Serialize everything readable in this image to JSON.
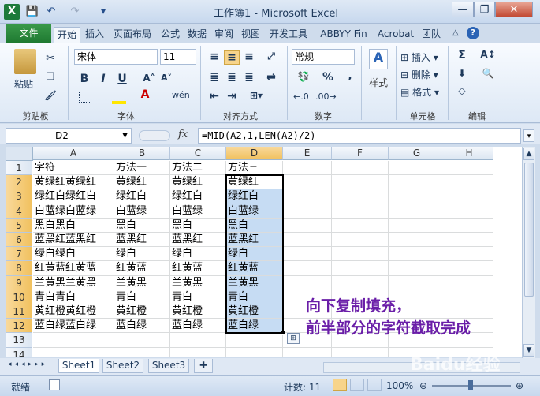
{
  "window": {
    "title": "工作簿1 - Microsoft Excel",
    "app_icon": "X",
    "qat": [
      "💾",
      "↶",
      "↷",
      "▾"
    ],
    "controls": [
      "—",
      "❐",
      "✕"
    ]
  },
  "ribbon_tabs": [
    "文件",
    "开始",
    "插入",
    "页面布局",
    "公式",
    "数据",
    "审阅",
    "视图",
    "开发工具",
    "ABBYY Fin",
    "Acrobat",
    "团队"
  ],
  "ribbon": {
    "clipboard": {
      "paste": "粘贴",
      "label": "剪贴板"
    },
    "font": {
      "name": "宋体",
      "size": "11",
      "label": "字体",
      "bold": "B",
      "italic": "I",
      "underline": "U",
      "grow": "A˄",
      "shrink": "A˅",
      "pinyin": "wén"
    },
    "alignment": {
      "label": "对齐方式"
    },
    "number": {
      "format": "常规",
      "label": "数字",
      "percent": "%",
      "comma": ","
    },
    "styles": {
      "label": "样式"
    },
    "cells": {
      "insert": "插入",
      "delete": "删除",
      "format": "格式",
      "label": "单元格"
    },
    "editing": {
      "label": "编辑",
      "sum": "Σ"
    }
  },
  "formula_bar": {
    "cell_ref": "D2",
    "fx": "fx",
    "formula": "=MID(A2,1,LEN(A2)/2)"
  },
  "columns": [
    "A",
    "B",
    "C",
    "D",
    "E",
    "F",
    "G",
    "H"
  ],
  "selected_column": "D",
  "rows": [
    [
      "字符",
      "方法一",
      "方法二",
      "方法三"
    ],
    [
      "黄绿红黄绿红",
      "黄绿红",
      "黄绿红",
      "黄绿红"
    ],
    [
      "绿红白绿红白",
      "绿红白",
      "绿红白",
      "绿红白"
    ],
    [
      "白蓝绿白蓝绿",
      "白蓝绿",
      "白蓝绿",
      "白蓝绿"
    ],
    [
      "黑白黑白",
      "黑白",
      "黑白",
      "黑白"
    ],
    [
      "蓝黑红蓝黑红",
      "蓝黑红",
      "蓝黑红",
      "蓝黑红"
    ],
    [
      "绿白绿白",
      "绿白",
      "绿白",
      "绿白"
    ],
    [
      "红黄蓝红黄蓝",
      "红黄蓝",
      "红黄蓝",
      "红黄蓝"
    ],
    [
      "兰黄黑兰黄黑",
      "兰黄黑",
      "兰黄黑",
      "兰黄黑"
    ],
    [
      "青白青白",
      "青白",
      "青白",
      "青白"
    ],
    [
      "黄红橙黄红橙",
      "黄红橙",
      "黄红橙",
      "黄红橙"
    ],
    [
      "蓝白绿蓝白绿",
      "蓝白绿",
      "蓝白绿",
      "蓝白绿"
    ],
    [
      "",
      "",
      "",
      ""
    ],
    [
      "",
      "",
      "",
      ""
    ]
  ],
  "annotation": {
    "line1": "向下复制填充，",
    "line2": "前半部分的字符截取完成"
  },
  "sheets": [
    "Sheet1",
    "Sheet2",
    "Sheet3"
  ],
  "status": {
    "ready": "就绪",
    "count": "计数: 11",
    "zoom": "100%"
  },
  "watermark": "Baidu经验",
  "colors": {
    "selection_fill": "#c6dcf3",
    "annotation": "#6a1ea8",
    "file_tab": "#1f7a31"
  }
}
